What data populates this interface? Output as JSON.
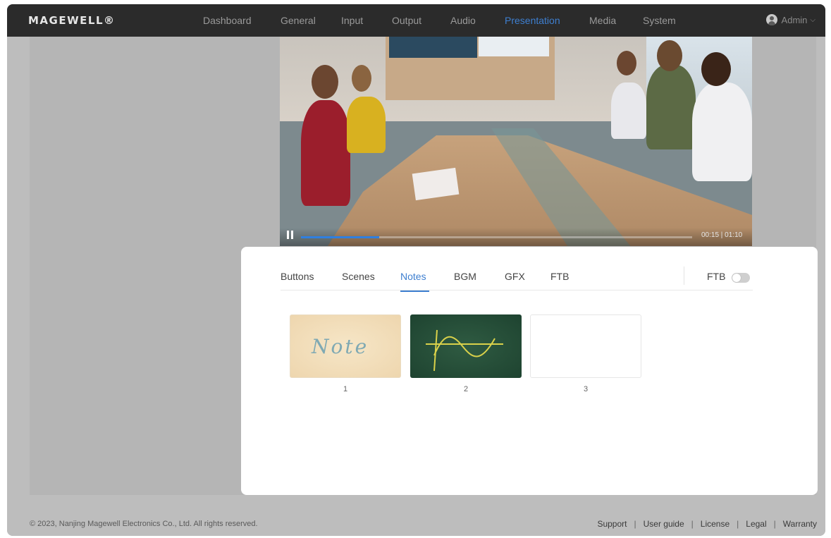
{
  "app": {
    "logo_text": "MAGEWELL®"
  },
  "nav": {
    "items": [
      {
        "label": "Dashboard",
        "active": false
      },
      {
        "label": "General",
        "active": false
      },
      {
        "label": "Input",
        "active": false
      },
      {
        "label": "Output",
        "active": false
      },
      {
        "label": "Audio",
        "active": false
      },
      {
        "label": "Presentation",
        "active": true
      },
      {
        "label": "Media",
        "active": false
      },
      {
        "label": "System",
        "active": false
      }
    ],
    "user": {
      "name": "Admin",
      "icon": "user-avatar-icon"
    }
  },
  "player": {
    "time_text": "00:15 | 01:10",
    "progress_fraction": 0.2,
    "pause_icon": "pause-icon"
  },
  "panel": {
    "tabs": [
      {
        "label": "Buttons",
        "active": false
      },
      {
        "label": "Scenes",
        "active": false
      },
      {
        "label": "Notes",
        "active": true
      },
      {
        "label": "BGM",
        "active": false
      },
      {
        "label": "GFX",
        "active": false
      },
      {
        "label": "FTB",
        "active": false
      }
    ],
    "ftb_toggle": {
      "label": "FTB",
      "on": false
    },
    "notes": [
      {
        "number": "1",
        "script_text": "Note"
      },
      {
        "number": "2"
      },
      {
        "number": "3"
      }
    ]
  },
  "footer": {
    "copyright": "© 2023, Nanjing Magewell Electronics Co., Ltd. All rights reserved.",
    "links": [
      "Support",
      "User guide",
      "License",
      "Legal",
      "Warranty"
    ]
  },
  "colors": {
    "accent": "#3e7fd0",
    "topbar": "#2b2b2b",
    "progress": "#2f7fe0"
  }
}
